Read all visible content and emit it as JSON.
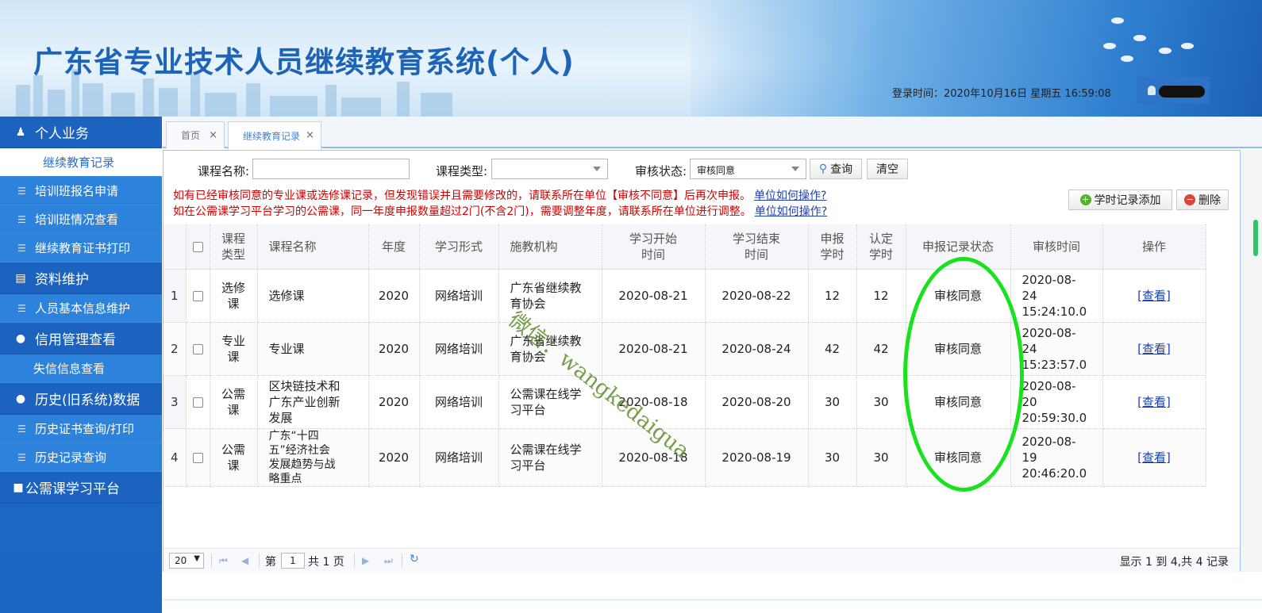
{
  "header": {
    "title": "广东省专业技术人员继续教育系统(个人)",
    "login_time": "登录时间：2020年10月16日   星期五   16:59:08"
  },
  "sidebar": {
    "sections": [
      {
        "label": "个人业务",
        "icon": "user-icon",
        "items": [
          {
            "label": "继续教育记录",
            "active": true
          },
          {
            "label": "培训班报名申请",
            "icon": "list-icon"
          },
          {
            "label": "培训班情况查看",
            "icon": "list-icon"
          },
          {
            "label": "继续教育证书打印",
            "icon": "list-icon"
          }
        ]
      },
      {
        "label": "资料维护",
        "icon": "card-icon",
        "items": [
          {
            "label": "人员基本信息维护",
            "icon": "list-icon"
          }
        ]
      },
      {
        "label": "信用管理查看",
        "icon": "bulb-icon",
        "items": [
          {
            "label": "失信信息查看"
          }
        ]
      },
      {
        "label": "历史(旧系统)数据",
        "icon": "bulb-icon",
        "items": [
          {
            "label": "历史证书查询/打印",
            "icon": "list-icon"
          },
          {
            "label": "历史记录查询",
            "icon": "list-icon"
          }
        ]
      },
      {
        "label": "公需课学习平台",
        "icon": "square-icon",
        "items": []
      }
    ]
  },
  "tabs": [
    {
      "label": "首页",
      "close": "×"
    },
    {
      "label": "继续教育记录",
      "close": "×",
      "active": true
    }
  ],
  "filters": {
    "course_name_label": "课程名称:",
    "course_name_value": "",
    "course_type_label": "课程类型:",
    "course_type_value": "",
    "status_label": "审核状态:",
    "status_value": "审核同意",
    "query_button": "查询",
    "clear_button": "清空"
  },
  "notices": [
    {
      "text": "如有已经审核同意的专业课或选修课记录，但发现错误并且需要修改的，请联系所在单位【审核不同意】后再次申报。",
      "link": "单位如何操作?"
    },
    {
      "text": "如在公需课学习平台学习的公需课，同一年度申报数量超过2门(不含2门)，需要调整年度，请联系所在单位进行调整。",
      "link": "单位如何操作?"
    }
  ],
  "actions": {
    "add_button": "学时记录添加",
    "delete_button": "删除"
  },
  "table": {
    "columns": [
      "课程\n类型",
      "课程名称",
      "年度",
      "学习形式",
      "施教机构",
      "学习开始\n时间",
      "学习结束\n时间",
      "申报\n学时",
      "认定\n学时",
      "申报记录状态",
      "审核时间",
      "操作"
    ],
    "rows": [
      {
        "no": "1",
        "type": "选修\n课",
        "name": "选修课",
        "year": "2020",
        "form": "网络培训",
        "org": "广东省继续教\n育协会",
        "start": "2020-08-21",
        "end": "2020-08-22",
        "declared": "12",
        "approved": "12",
        "status": "审核同意",
        "audit_time": "2020-08-\n24\n15:24:10.0",
        "action": "[查看]"
      },
      {
        "no": "2",
        "type": "专业\n课",
        "name": "专业课",
        "year": "2020",
        "form": "网络培训",
        "org": "广东省继续教\n育协会",
        "start": "2020-08-21",
        "end": "2020-08-24",
        "declared": "42",
        "approved": "42",
        "status": "审核同意",
        "audit_time": "2020-08-\n24\n15:23:57.0",
        "action": "[查看]"
      },
      {
        "no": "3",
        "type": "公需\n课",
        "name": "区块链技术和\n广东产业创新\n发展",
        "year": "2020",
        "form": "网络培训",
        "org": "公需课在线学\n习平台",
        "start": "2020-08-18",
        "end": "2020-08-20",
        "declared": "30",
        "approved": "30",
        "status": "审核同意",
        "audit_time": "2020-08-\n20\n20:59:30.0",
        "action": "[查看]"
      },
      {
        "no": "4",
        "type": "公需\n课",
        "name": "广东“十四\n五”经济社会\n发展趋势与战\n略重点",
        "year": "2020",
        "form": "网络培训",
        "org": "公需课在线学\n习平台",
        "start": "2020-08-18",
        "end": "2020-08-19",
        "declared": "30",
        "approved": "30",
        "status": "审核同意",
        "audit_time": "2020-08-\n19\n20:46:20.0",
        "action": "[查看]"
      }
    ]
  },
  "pager": {
    "page_size": "20",
    "page_prefix": "第",
    "page_value": "1",
    "page_suffix": "共 1 页",
    "info": "显示 1 到 4,共 4 记录"
  },
  "watermark": "微信：wangkedaigua"
}
